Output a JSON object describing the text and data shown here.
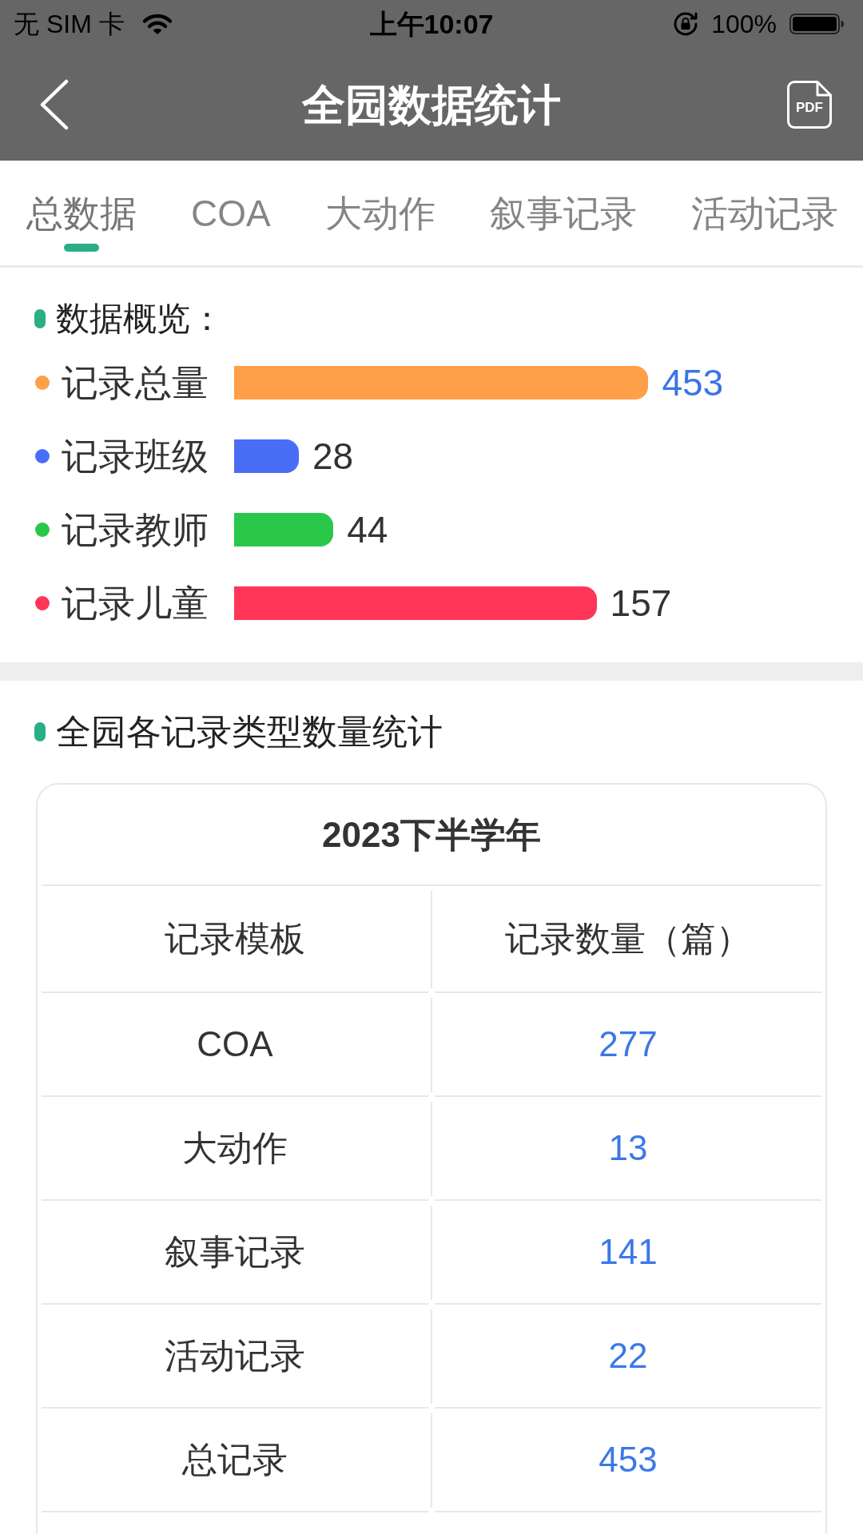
{
  "status_bar": {
    "carrier": "无 SIM 卡",
    "time": "上午10:07",
    "battery": "100%"
  },
  "nav_bar": {
    "title": "全园数据统计",
    "file_button": {
      "label": "PDF"
    }
  },
  "tabs": [
    {
      "label": "总数据",
      "selected": true
    },
    {
      "label": "COA",
      "selected": false
    },
    {
      "label": "大动作",
      "selected": false
    },
    {
      "label": "叙事记录",
      "selected": false
    },
    {
      "label": "活动记录",
      "selected": false
    }
  ],
  "overview": {
    "title": "数据概览：",
    "items": [
      {
        "label": "记录总量",
        "value": "453",
        "color": "#ff9f47",
        "level": 0.96,
        "highlighted": true
      },
      {
        "label": "记录班级",
        "value": "28",
        "color": "#4a6df6",
        "level": 0.15,
        "highlighted": false
      },
      {
        "label": "记录教师",
        "value": "44",
        "color": "#29c74a",
        "level": 0.23,
        "highlighted": false
      },
      {
        "label": "记录儿童",
        "value": "157",
        "color": "#ff3657",
        "level": 0.84,
        "highlighted": false
      }
    ]
  },
  "record_types": {
    "title": "全园各记录类型数量统计",
    "table": {
      "caption": "2023下半学年",
      "columns": [
        "记录模板",
        "记录数量（篇）"
      ],
      "rows": [
        [
          "COA",
          "277"
        ],
        [
          "大动作",
          "13"
        ],
        [
          "叙事记录",
          "141"
        ],
        [
          "活动记录",
          "22"
        ],
        [
          "总记录",
          "453"
        ]
      ]
    }
  }
}
